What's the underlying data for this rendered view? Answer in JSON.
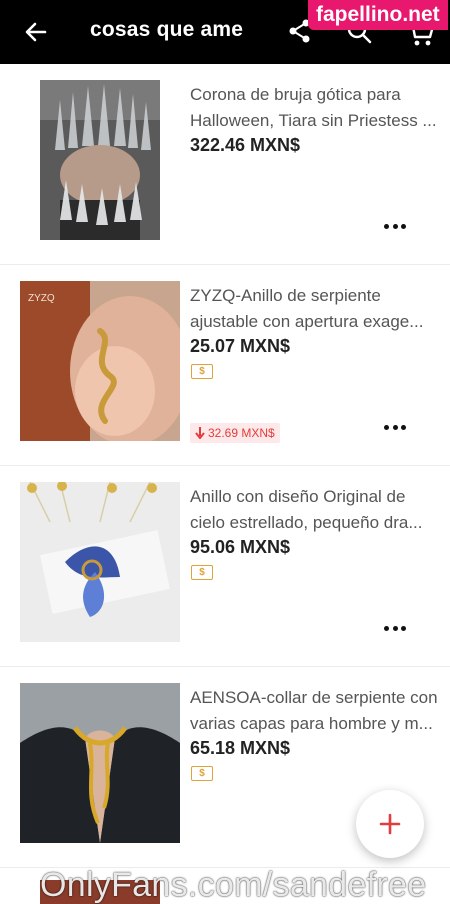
{
  "header": {
    "title": "cosas que ame",
    "icons": [
      "arrow-left-icon",
      "share-icon",
      "search-icon",
      "cart-icon"
    ]
  },
  "watermarks": {
    "top": "fapellino.net",
    "bottom": "OnlyFans.com/sandefree"
  },
  "items": [
    {
      "name_line1": "Corona de bruja gótica para",
      "name_line2": "Halloween, Tiara sin Priestess ...",
      "price": "322.46 MXN$",
      "has_coupon": false,
      "price_drop": ""
    },
    {
      "name_line1": "ZYZQ-Anillo de serpiente",
      "name_line2": "ajustable con apertura exage...",
      "price": "25.07 MXN$",
      "has_coupon": true,
      "coupon_label": "$",
      "price_drop": "32.69 MXN$",
      "image_brand": "ZYZQ"
    },
    {
      "name_line1": "Anillo con diseño Original de",
      "name_line2": "cielo estrellado, pequeño dra...",
      "price": "95.06 MXN$",
      "has_coupon": true,
      "coupon_label": "$",
      "price_drop": ""
    },
    {
      "name_line1": "AENSOA-collar de serpiente con",
      "name_line2": "varias capas para hombre y m...",
      "price": "65.18 MXN$",
      "has_coupon": true,
      "coupon_label": "$",
      "price_drop": ""
    }
  ],
  "colors": {
    "topbar": "#000000",
    "accent_red": "#e43c3c",
    "coupon": "#e0a23a",
    "watermark_pink": "#e8186e"
  }
}
